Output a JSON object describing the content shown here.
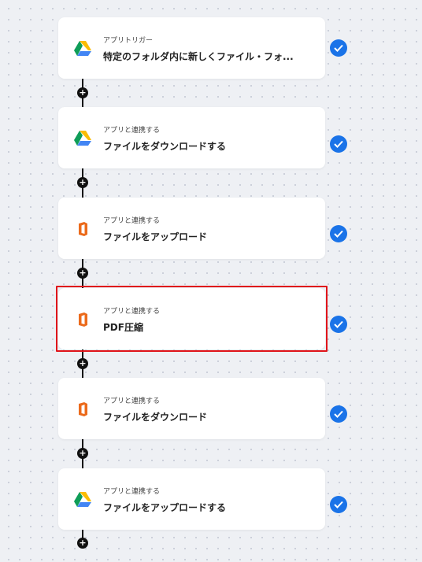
{
  "steps": [
    {
      "app": "google-drive-icon",
      "subtitle": "アプリトリガー",
      "title": "特定のフォルダ内に新しくファイル・フォ...",
      "completed": true
    },
    {
      "app": "google-drive-icon",
      "subtitle": "アプリと連携する",
      "title": "ファイルをダウンロードする",
      "completed": true
    },
    {
      "app": "office-icon",
      "subtitle": "アプリと連携する",
      "title": "ファイルをアップロード",
      "completed": true
    },
    {
      "app": "office-icon",
      "subtitle": "アプリと連携する",
      "title": "PDF圧縮",
      "completed": true,
      "highlighted": true
    },
    {
      "app": "office-icon",
      "subtitle": "アプリと連携する",
      "title": "ファイルをダウンロード",
      "completed": true
    },
    {
      "app": "google-drive-icon",
      "subtitle": "アプリと連携する",
      "title": "ファイルをアップロードする",
      "completed": true
    }
  ],
  "add_step_symbol": "+",
  "colors": {
    "check": "#1a73e8",
    "highlight": "#e0141a",
    "office": "#eb6a1b"
  }
}
